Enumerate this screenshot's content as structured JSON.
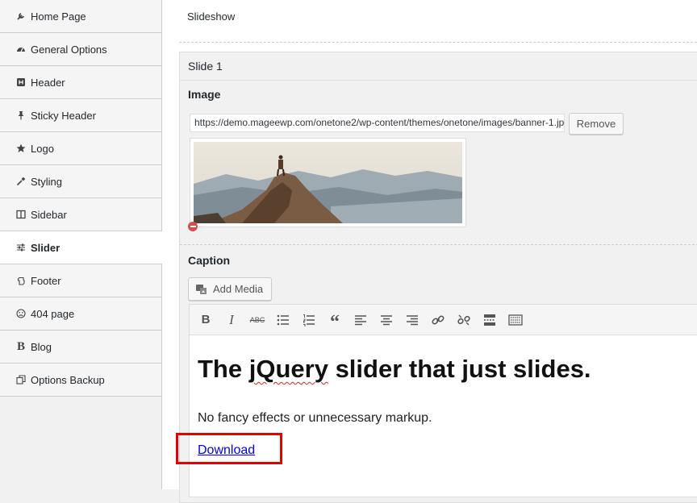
{
  "sidebar": {
    "items": [
      {
        "label": "Home Page",
        "icon": "wrench-icon"
      },
      {
        "label": "General Options",
        "icon": "gauge-icon"
      },
      {
        "label": "Header",
        "icon": "header-icon"
      },
      {
        "label": "Sticky Header",
        "icon": "pin-icon"
      },
      {
        "label": "Logo",
        "icon": "star-icon"
      },
      {
        "label": "Styling",
        "icon": "eyedropper-icon"
      },
      {
        "label": "Sidebar",
        "icon": "columns-icon"
      },
      {
        "label": "Slider",
        "icon": "sliders-icon"
      },
      {
        "label": "Footer",
        "icon": "hand-icon"
      },
      {
        "label": "404 page",
        "icon": "frown-icon"
      },
      {
        "label": "Blog",
        "icon": "b-icon"
      },
      {
        "label": "Options Backup",
        "icon": "copy-icon"
      }
    ],
    "active": "Slider"
  },
  "main": {
    "section_title": "Slideshow",
    "slide": {
      "title": "Slide 1",
      "image_label": "Image",
      "image_url": "https://demo.mageewp.com/onetone2/wp-content/themes/onetone/images/banner-1.jpg",
      "remove_button": "Remove",
      "caption_label": "Caption",
      "add_media_button": "Add Media",
      "editor": {
        "toolbar": [
          "bold-icon",
          "italic-icon",
          "strikethrough-icon",
          "bullet-list-icon",
          "numbered-list-icon",
          "blockquote-icon",
          "align-left-icon",
          "align-center-icon",
          "align-right-icon",
          "link-icon",
          "unlink-icon",
          "read-more-icon",
          "toolbar-toggle-icon"
        ],
        "heading_pre": "The ",
        "heading_misspelled": "jQuery",
        "heading_post": " slider that just slides.",
        "paragraph": "No fancy effects or unnecessary markup.",
        "link_text": "Download"
      }
    }
  },
  "colors": {
    "highlight": "#e60000",
    "link": "#0000ee",
    "remove_icon": "#d54e4e"
  }
}
